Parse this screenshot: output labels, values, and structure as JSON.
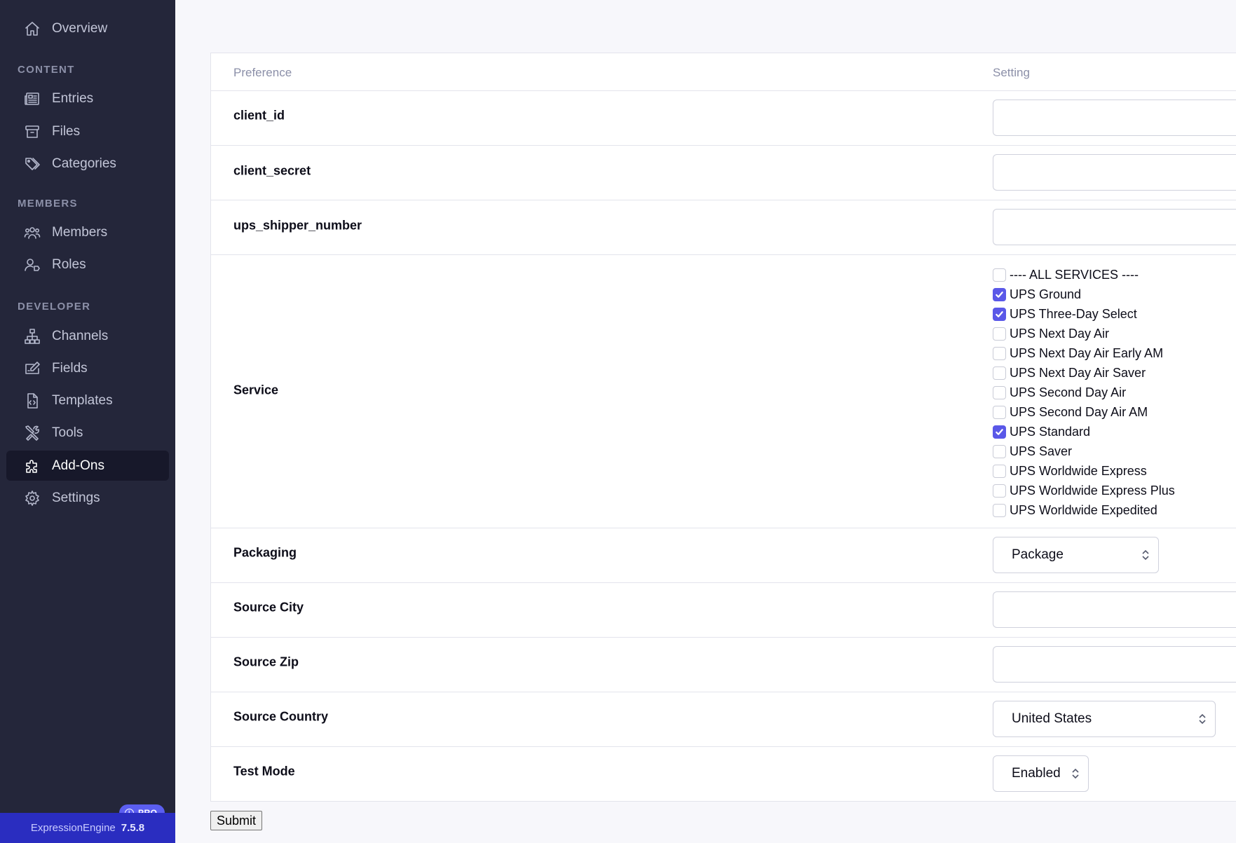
{
  "sidebar": {
    "overview": "Overview",
    "sections": {
      "content": "CONTENT",
      "members": "MEMBERS",
      "developer": "DEVELOPER"
    },
    "items": {
      "entries": "Entries",
      "files": "Files",
      "categories": "Categories",
      "members": "Members",
      "roles": "Roles",
      "channels": "Channels",
      "fields": "Fields",
      "templates": "Templates",
      "tools": "Tools",
      "addons": "Add-Ons",
      "settings": "Settings"
    },
    "active_item": "Add-Ons",
    "badge": "PRO",
    "badge_icon": "info-icon",
    "footer_brand": "ExpressionEngine",
    "footer_version": "7.5.8"
  },
  "table": {
    "col_preference": "Preference",
    "col_setting": "Setting",
    "rows": {
      "client_id": "client_id",
      "client_secret": "client_secret",
      "ups_shipper_number": "ups_shipper_number",
      "service": "Service",
      "packaging": "Packaging",
      "source_city": "Source City",
      "source_zip": "Source Zip",
      "source_country": "Source Country",
      "test_mode": "Test Mode"
    },
    "values": {
      "client_id": "",
      "client_secret": "",
      "ups_shipper_number": "",
      "source_city": "",
      "source_zip": ""
    },
    "services": [
      {
        "label": "---- ALL SERVICES ----",
        "checked": false
      },
      {
        "label": "UPS Ground",
        "checked": true
      },
      {
        "label": "UPS Three-Day Select",
        "checked": true
      },
      {
        "label": "UPS Next Day Air",
        "checked": false
      },
      {
        "label": "UPS Next Day Air Early AM",
        "checked": false
      },
      {
        "label": "UPS Next Day Air Saver",
        "checked": false
      },
      {
        "label": "UPS Second Day Air",
        "checked": false
      },
      {
        "label": "UPS Second Day Air AM",
        "checked": false
      },
      {
        "label": "UPS Standard",
        "checked": true
      },
      {
        "label": "UPS Saver",
        "checked": false
      },
      {
        "label": "UPS Worldwide Express",
        "checked": false
      },
      {
        "label": "UPS Worldwide Express Plus",
        "checked": false
      },
      {
        "label": "UPS Worldwide Expedited",
        "checked": false
      }
    ],
    "packaging_value": "Package",
    "source_country_value": "United States",
    "test_mode_value": "Enabled"
  },
  "submit_label": "Submit",
  "colors": {
    "sidebar_bg": "#24263a",
    "active_bg": "#17182a",
    "footer_bg": "#2a2dc0",
    "checkbox_checked": "#5a58e8",
    "badge_bg": "#5b5ef0"
  }
}
